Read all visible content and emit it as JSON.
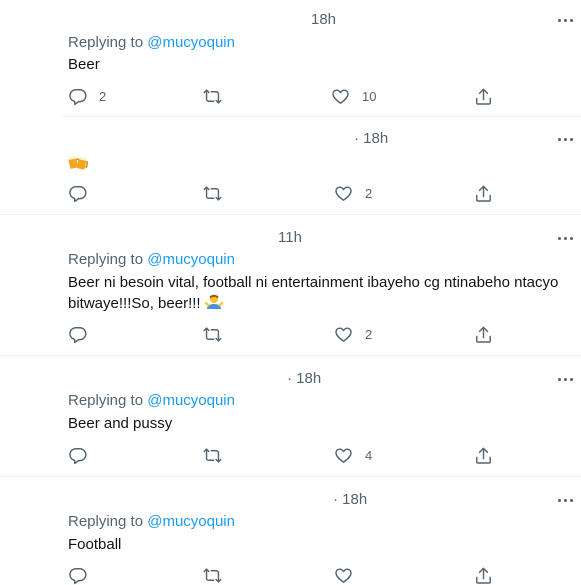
{
  "tweets": [
    {
      "time": "18h",
      "replying_prefix": "Replying to ",
      "replying_handle": "@mucyoquin",
      "text": "Beer",
      "reply_count": "2",
      "retweet_count": "",
      "like_count": "10"
    },
    {
      "time": "· 18h",
      "emoji": "beer-mugs-emoji",
      "reply_count": "",
      "retweet_count": "",
      "like_count": "2"
    },
    {
      "time": "11h",
      "replying_prefix": "Replying to ",
      "replying_handle": "@mucyoquin",
      "text_line1": "Beer ni besoin vital, football ni entertainment ibayeho cg ntinabeho ntacyo",
      "text_line2": "bitwaye!!!So, beer!!!",
      "emoji": "person-shrugging-emoji",
      "reply_count": "",
      "retweet_count": "",
      "like_count": "2"
    },
    {
      "time": "· 18h",
      "replying_prefix": "Replying to ",
      "replying_handle": "@mucyoquin",
      "text": "Beer and pussy",
      "reply_count": "",
      "retweet_count": "",
      "like_count": "4"
    },
    {
      "time": "· 18h",
      "replying_prefix": "Replying to ",
      "replying_handle": "@mucyoquin",
      "text": "Football"
    }
  ],
  "colors": {
    "text": "#0f1419",
    "secondary": "#536471",
    "link": "#1d9bf0",
    "divider": "#eff3f4"
  },
  "icons": [
    "reply-icon",
    "retweet-icon",
    "like-icon",
    "share-icon",
    "more-icon"
  ]
}
